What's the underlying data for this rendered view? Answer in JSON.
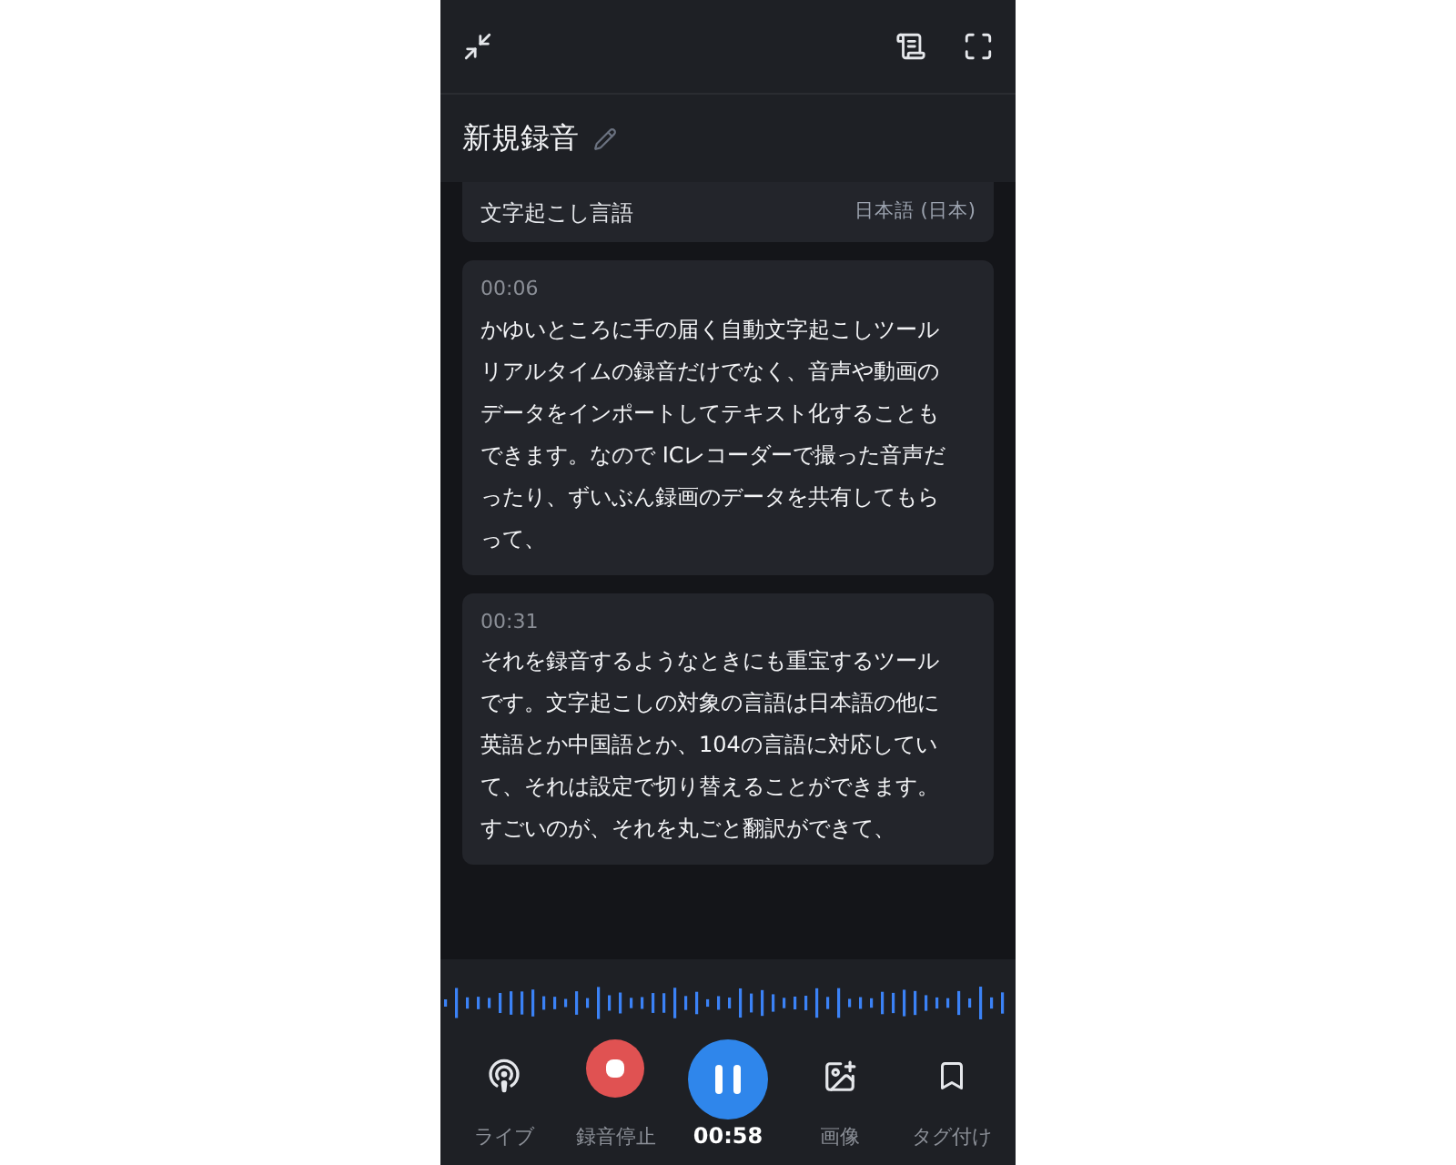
{
  "title": "新規録音",
  "language_setting": {
    "label": "文字起こし言語",
    "value": "日本語 (日本)"
  },
  "segments": [
    {
      "time": "00:06",
      "lines": [
        "かゆいところに手の届く自動文字起こしツール",
        "リアルタイムの録音だけでなく、音声や動画の",
        "データをインポートしてテキスト化することも",
        "できます。なので ICレコーダーで撮った音声だ",
        "ったり、ずいぶん録画のデータを共有してもら",
        "って、"
      ]
    },
    {
      "time": "00:31",
      "lines": [
        "それを録音するようなときにも重宝するツール",
        "です。文字起こしの対象の言語は日本語の他に",
        "英語とか中国語とか、104の言語に対応してい",
        "て、それは設定で切り替えることができます。",
        "すごいのが、それを丸ごと翻訳ができて、"
      ]
    }
  ],
  "controls": [
    {
      "kind": "live",
      "label": "ライブ"
    },
    {
      "kind": "stop",
      "label": "録音停止"
    },
    {
      "kind": "pause",
      "label": "00:58"
    },
    {
      "kind": "image",
      "label": "画像"
    },
    {
      "kind": "tag",
      "label": "タグ付け"
    }
  ]
}
